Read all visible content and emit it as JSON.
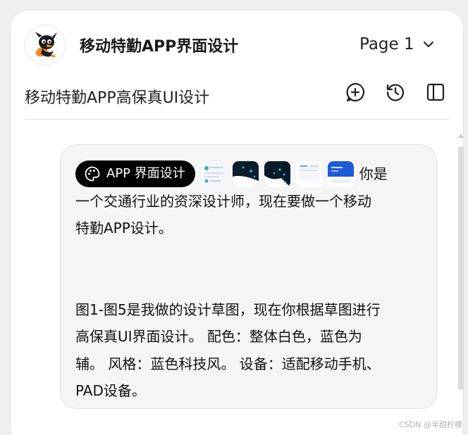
{
  "header": {
    "app_title": "移动特勤APP界面设计",
    "page_select": "Page 1"
  },
  "subbar": {
    "subtitle": "移动特勤APP高保真UI设计",
    "icons": [
      "add-circle-icon",
      "history-icon",
      "sidebar-panel-icon"
    ]
  },
  "message": {
    "tag_label": "APP 界面设计",
    "first_line_text": "你是",
    "lines": [
      "一个交通行业的资深设计师，现在要做一个移动",
      "特勤APP设计。",
      "",
      "",
      "图1-图5是我做的设计草图，现在你根据草图进行",
      "高保真UI界面设计。 配色：整体白色，蓝色为",
      "辅。 风格：蓝色科技风。 设备：适配移动手机、",
      "PAD设备。"
    ],
    "attachments": [
      "sketch-1-thumbnail",
      "sketch-2-thumbnail",
      "sketch-3-thumbnail",
      "sketch-4-thumbnail",
      "sketch-5-thumbnail"
    ]
  },
  "watermark": "CSDN @半甜柠檬",
  "colors": {
    "tag_bg": "#000000",
    "bubble_bg": "#f5f5f5",
    "panel_bg": "#ffffff",
    "accent_blue": "#2f6fd6"
  }
}
